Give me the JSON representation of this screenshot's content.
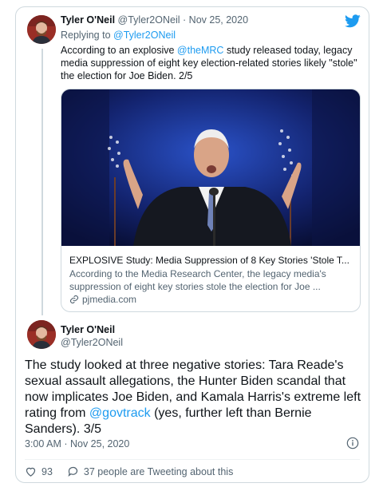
{
  "tweet1": {
    "author_name": "Tyler O'Neil",
    "author_handle": "@Tyler2ONeil",
    "separator": "·",
    "date": "Nov 25, 2020",
    "reply_prefix": "Replying to ",
    "reply_to": "@Tyler2ONeil",
    "text_before": "According to an explosive ",
    "mention": "@theMRC",
    "text_after": " study released today, legacy media suppression of eight key election-related stories likely \"stole\" the election for Joe Biden. 2/5",
    "link_card": {
      "title": "EXPLOSIVE Study: Media Suppression of 8 Key Stories 'Stole T...",
      "description": "According to the Media Research Center, the legacy media's suppression of eight key stories stole the election for Joe ...",
      "domain": "pjmedia.com"
    }
  },
  "tweet2": {
    "author_name": "Tyler O'Neil",
    "author_handle": "@Tyler2ONeil",
    "text_before": "The study looked at three negative stories: Tara Reade's sexual assault allegations, the Hunter Biden scandal that now implicates Joe Biden, and Kamala Harris's extreme left rating from ",
    "mention": "@govtrack",
    "text_after": " (yes, further left than Bernie Sanders). 3/5",
    "timestamp": "3:00 AM · Nov 25, 2020",
    "like_count": "93",
    "comments_text": "37 people are Tweeting about this"
  },
  "colors": {
    "accent": "#1d9bf0",
    "muted": "#536471",
    "border": "#cfd9de"
  },
  "icons": [
    "twitter-bird-icon",
    "link-icon",
    "info-icon",
    "heart-icon",
    "comment-icon"
  ]
}
